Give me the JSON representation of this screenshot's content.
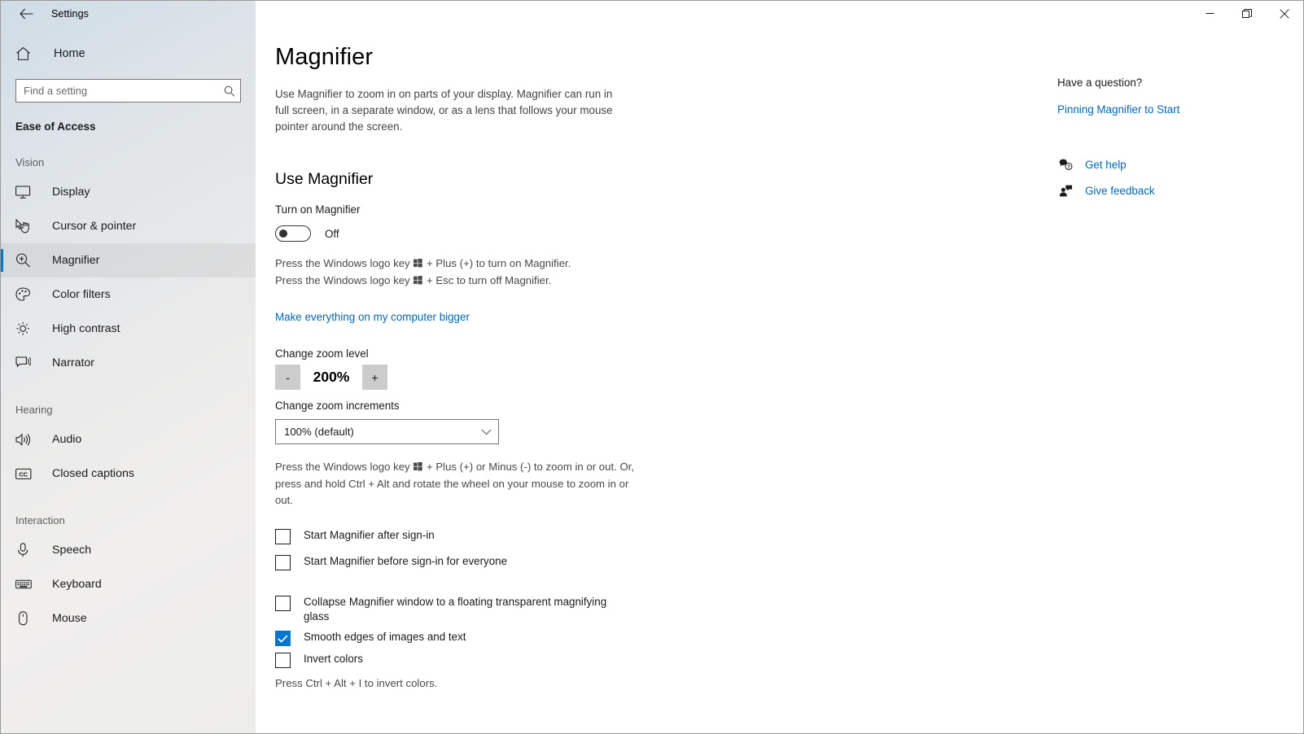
{
  "window": {
    "title": "Settings",
    "back_label": "Back",
    "minimize_label": "Minimize",
    "restore_label": "Restore",
    "close_label": "Close"
  },
  "sidebar": {
    "home_label": "Home",
    "search": {
      "placeholder": "Find a setting",
      "value": ""
    },
    "category": "Ease of Access",
    "groups": [
      {
        "label": "Vision",
        "items": [
          {
            "label": "Display",
            "icon": "monitor-icon",
            "selected": false
          },
          {
            "label": "Cursor & pointer",
            "icon": "cursor-pointer-icon",
            "selected": false
          },
          {
            "label": "Magnifier",
            "icon": "magnifier-icon",
            "selected": true
          },
          {
            "label": "Color filters",
            "icon": "palette-icon",
            "selected": false
          },
          {
            "label": "High contrast",
            "icon": "brightness-icon",
            "selected": false
          },
          {
            "label": "Narrator",
            "icon": "narrator-icon",
            "selected": false
          }
        ]
      },
      {
        "label": "Hearing",
        "items": [
          {
            "label": "Audio",
            "icon": "speaker-icon",
            "selected": false
          },
          {
            "label": "Closed captions",
            "icon": "closed-captions-icon",
            "selected": false
          }
        ]
      },
      {
        "label": "Interaction",
        "items": [
          {
            "label": "Speech",
            "icon": "microphone-icon",
            "selected": false
          },
          {
            "label": "Keyboard",
            "icon": "keyboard-icon",
            "selected": false
          },
          {
            "label": "Mouse",
            "icon": "mouse-icon",
            "selected": false
          }
        ]
      }
    ]
  },
  "main": {
    "title": "Magnifier",
    "description": "Use Magnifier to zoom in on parts of your display. Magnifier can run in full screen, in a separate window, or as a lens that follows your mouse pointer around the screen.",
    "section_heading": "Use Magnifier",
    "toggle": {
      "label": "Turn on Magnifier",
      "state": "Off",
      "checked": false
    },
    "shortcut_on_prefix": "Press the Windows logo key ",
    "shortcut_on_suffix": " + Plus (+) to turn on Magnifier.",
    "shortcut_off_prefix": "Press the Windows logo key ",
    "shortcut_off_suffix": " + Esc to turn off Magnifier.",
    "bigger_link": "Make everything on my computer bigger",
    "zoom_level_label": "Change zoom level",
    "zoom_decrease": "-",
    "zoom_value": "200%",
    "zoom_increase": "+",
    "zoom_increments_label": "Change zoom increments",
    "zoom_increments_value": "100% (default)",
    "zoom_increments_options": [
      "100% (default)"
    ],
    "zoom_hint_prefix": "Press the Windows logo key ",
    "zoom_hint_suffix": " + Plus (+) or Minus (-) to zoom in or out. Or, press and hold Ctrl + Alt and rotate the wheel on your mouse to zoom in or out.",
    "checkboxes": [
      {
        "label": "Start Magnifier after sign-in",
        "checked": false
      },
      {
        "label": "Start Magnifier before sign-in for everyone",
        "checked": false
      },
      {
        "label": "Collapse Magnifier window to a floating transparent magnifying glass",
        "checked": false
      },
      {
        "label": "Smooth edges of images and text",
        "checked": true
      },
      {
        "label": "Invert colors",
        "checked": false
      }
    ],
    "invert_hint": "Press Ctrl + Alt + I to invert colors."
  },
  "right_panel": {
    "question_title": "Have a question?",
    "question_link": "Pinning Magnifier to Start",
    "get_help": "Get help",
    "give_feedback": "Give feedback"
  },
  "colors": {
    "accent": "#0078d4",
    "link": "#0067c0",
    "checkbox_checked": "#0078d4"
  }
}
